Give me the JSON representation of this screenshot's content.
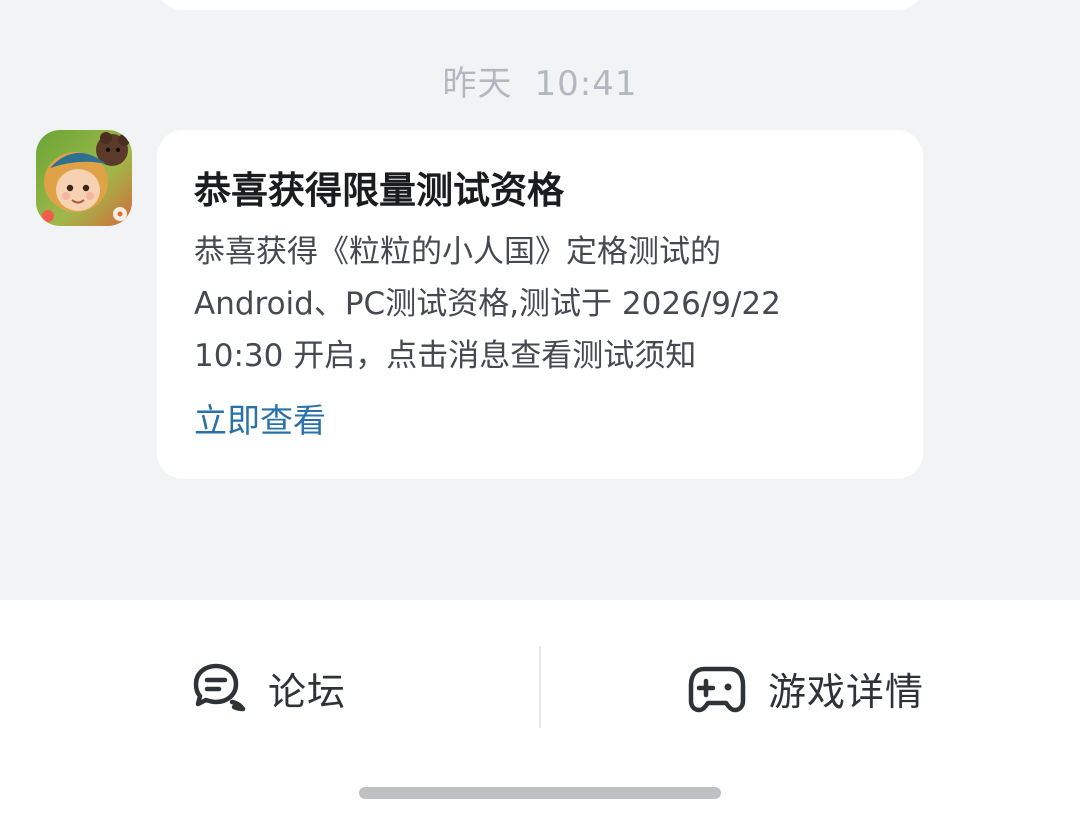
{
  "conversation": {
    "timestamp_day": "昨天",
    "timestamp_time": "10:41"
  },
  "message": {
    "sender_avatar": "game-app-icon",
    "title": "恭喜获得限量测试资格",
    "body_lines": [
      "恭喜获得《粒粒的小人国》定格测试的",
      "Android、PC测试资格,测试于 2026/9/22",
      "10:30 开启，点击消息查看测试须知"
    ],
    "action_label": "立即查看"
  },
  "bottom_bar": {
    "forum": {
      "label": "论坛",
      "icon": "chat-bubble-icon"
    },
    "game_details": {
      "label": "游戏详情",
      "icon": "gamepad-icon"
    }
  },
  "colors": {
    "background": "#f2f3f5",
    "card": "#ffffff",
    "link": "#2a71a8",
    "timestamp": "#b3b8c0"
  }
}
